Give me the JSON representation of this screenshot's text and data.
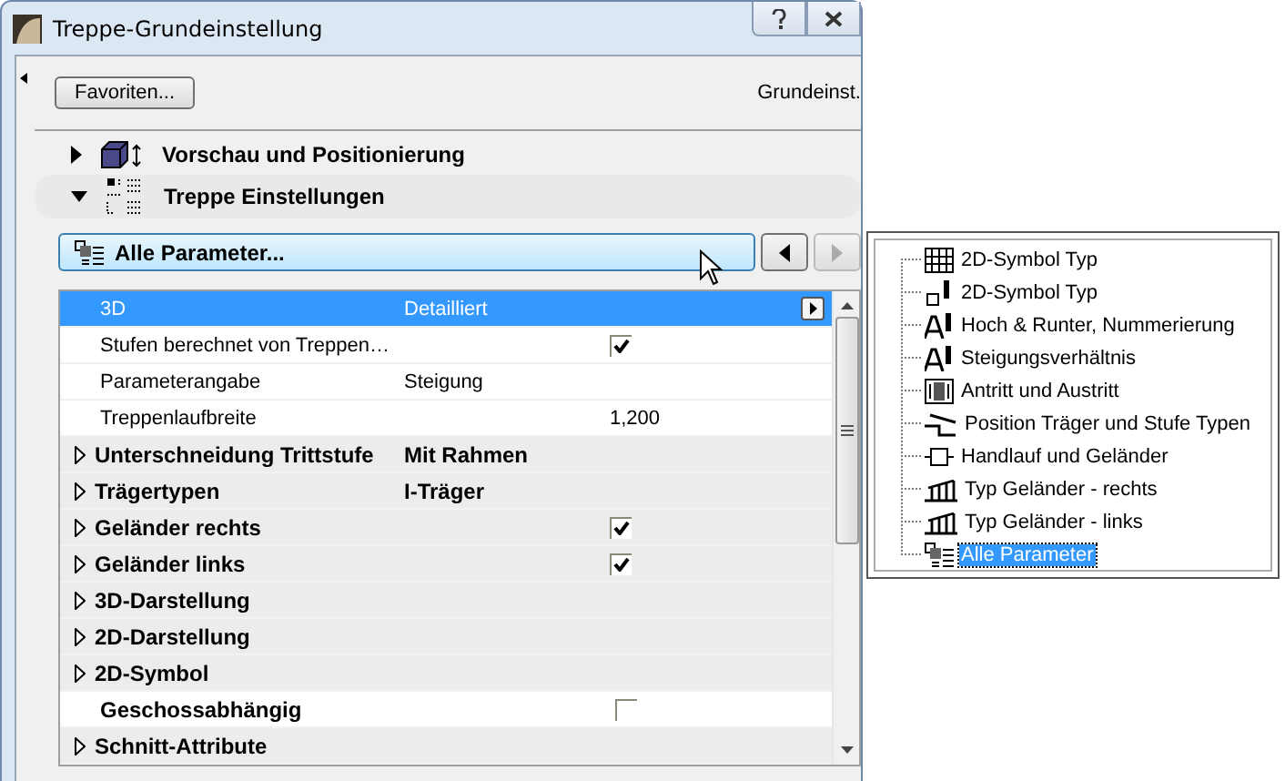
{
  "window": {
    "title": "Treppe-Grundeinstellung"
  },
  "favorites_button": "Favoriten...",
  "header_right": "Grundeinst.",
  "sections": [
    {
      "label": "Vorschau und Positionierung",
      "expanded": false,
      "kind": "preview"
    },
    {
      "label": "Treppe Einstellungen",
      "expanded": true,
      "kind": "settings"
    }
  ],
  "panel_selector": {
    "label": "Alle Parameter...",
    "prev_disabled": false,
    "next_disabled": true
  },
  "params": [
    {
      "kind": "param",
      "name": "3D",
      "value": "Detailliert",
      "selected": true
    },
    {
      "kind": "param",
      "name": "Stufen berechnet von Treppen…",
      "checked": true,
      "selected": false
    },
    {
      "kind": "param",
      "name": "Parameterangabe",
      "value": "Steigung",
      "selected": false
    },
    {
      "kind": "param",
      "name": "Treppenlaufbreite",
      "number": "1,200",
      "selected": false
    },
    {
      "kind": "group",
      "name": "Unterschneidung Trittstufe",
      "value": "Mit Rahmen",
      "selected": false
    },
    {
      "kind": "group",
      "name": "Trägertypen",
      "value": "I-Träger",
      "selected": false
    },
    {
      "kind": "group",
      "name": "Geländer rechts",
      "checked": true,
      "selected": false
    },
    {
      "kind": "group",
      "name": "Geländer links",
      "checked": true,
      "selected": false
    },
    {
      "kind": "group",
      "name": "3D-Darstellung",
      "selected": false
    },
    {
      "kind": "group",
      "name": "2D-Darstellung",
      "selected": false
    },
    {
      "kind": "group",
      "name": "2D-Symbol",
      "selected": false
    },
    {
      "kind": "flag",
      "name": "Geschossabhängig",
      "checked": false,
      "selected": false
    },
    {
      "kind": "group",
      "name": "Schnitt-Attribute",
      "selected": false
    }
  ],
  "page_menu": [
    {
      "kind": "grid",
      "label": "2D-Symbol Typ",
      "selected": false
    },
    {
      "kind": "pen",
      "label": "2D-Symbol Typ",
      "selected": false
    },
    {
      "kind": "text",
      "label": "Hoch & Runter, Nummerierung",
      "selected": false
    },
    {
      "kind": "text",
      "label": "Steigungsverhältnis",
      "selected": false
    },
    {
      "kind": "door",
      "label": "Antritt und Austritt",
      "selected": false
    },
    {
      "kind": "step",
      "label": "Position Träger und Stufe Typen",
      "selected": false
    },
    {
      "kind": "rail",
      "label": "Handlauf und Geländer",
      "selected": false
    },
    {
      "kind": "fence",
      "label": "Typ Geländer - rechts",
      "selected": false
    },
    {
      "kind": "fence",
      "label": "Typ Geländer - links",
      "selected": false
    },
    {
      "kind": "list",
      "label": "Alle Parameter",
      "selected": true
    }
  ]
}
